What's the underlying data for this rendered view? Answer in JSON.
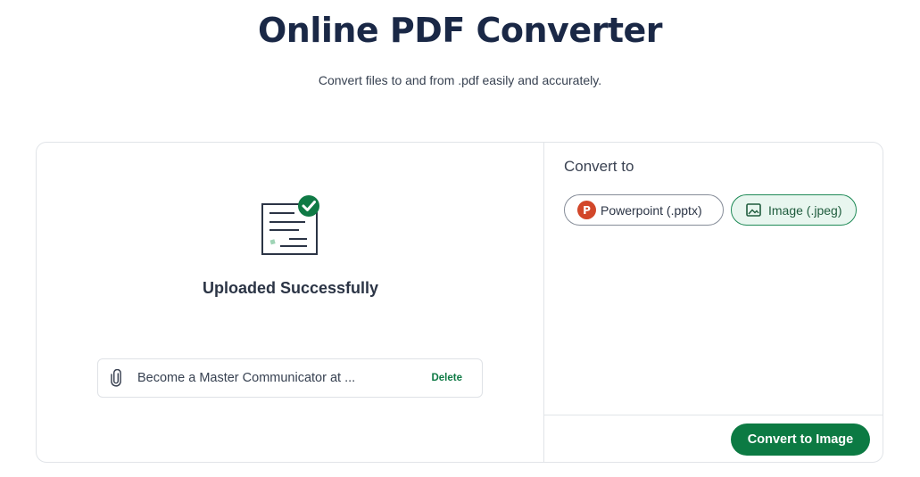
{
  "header": {
    "title": "Online PDF Converter",
    "subtitle": "Convert files to and from .pdf easily and accurately."
  },
  "upload": {
    "status": "Uploaded Successfully",
    "file_name": "Become a Master Communicator at ...",
    "delete_label": "Delete"
  },
  "convert": {
    "heading": "Convert to",
    "options": [
      {
        "label": "Powerpoint (.pptx)",
        "icon": "powerpoint-icon",
        "selected": false
      },
      {
        "label": "Image (.jpeg)",
        "icon": "image-icon",
        "selected": true
      }
    ],
    "button_label": "Convert to Image",
    "ppt_icon_letter": "P"
  },
  "colors": {
    "title": "#1a2846",
    "accent_green": "#0c7a43",
    "selected_bg": "#e8f6ef",
    "powerpoint_red": "#d2472a",
    "check_green": "#0f7a45"
  }
}
